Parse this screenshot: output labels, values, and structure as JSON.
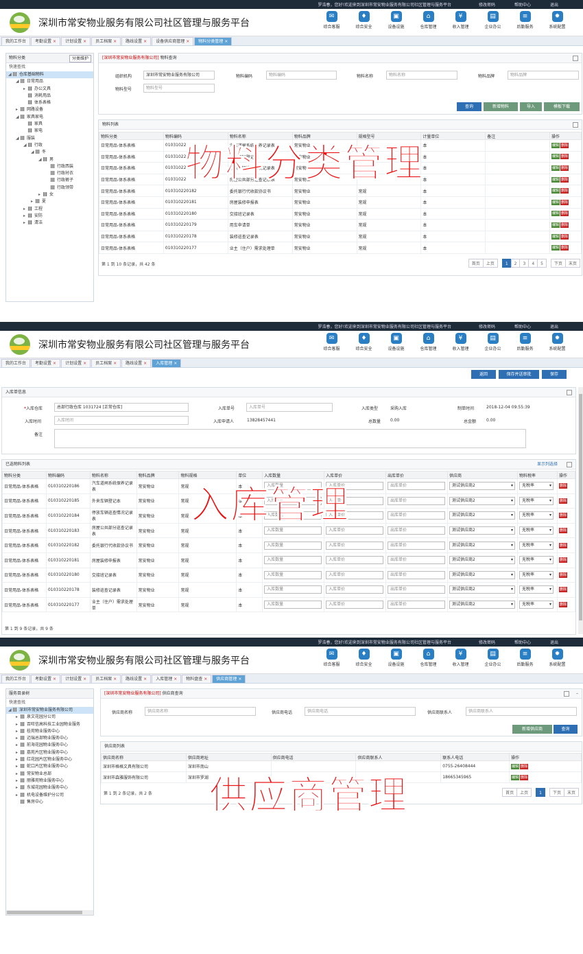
{
  "common": {
    "user": "罗浩春，您好!欢迎来到深圳市常安物业服务有限公司社区管理与服务平台",
    "links": [
      "修改密码",
      "帮助中心",
      "退出"
    ],
    "title": "深圳市常安物业服务有限公司社区管理与服务平台",
    "nav": [
      {
        "label": "综合客服",
        "icon": "✉"
      },
      {
        "label": "综合安全",
        "icon": "♦"
      },
      {
        "label": "设备设施",
        "icon": "▣"
      },
      {
        "label": "仓库管理",
        "icon": "⌂"
      },
      {
        "label": "收入管理",
        "icon": "¥"
      },
      {
        "label": "企业办公",
        "icon": "▤"
      },
      {
        "label": "后勤服务",
        "icon": "≡"
      },
      {
        "label": "系统配置",
        "icon": "✹"
      }
    ]
  },
  "s1": {
    "tabs": [
      "我的工作台",
      "考勤设置",
      "计划设置",
      "员工档案",
      "路线设置",
      "设备供应商管理",
      "物料分类管理"
    ],
    "side_title": "物料分类",
    "side_btn": "分类维护",
    "quick": "快速查找",
    "tree": [
      {
        "t": "仓库基础物料",
        "l": 0,
        "sel": true,
        "ar": "◢"
      },
      {
        "t": "日常用品",
        "l": 1,
        "ar": "◢"
      },
      {
        "t": "办公文具",
        "l": 2,
        "ar": "▸"
      },
      {
        "t": "消耗用品",
        "l": 2,
        "ar": ""
      },
      {
        "t": "体系表格",
        "l": 2,
        "ar": ""
      },
      {
        "t": "网路设备",
        "l": 1,
        "ar": "▸"
      },
      {
        "t": "家具家电",
        "l": 1,
        "ar": "◢"
      },
      {
        "t": "家具",
        "l": 2,
        "ar": ""
      },
      {
        "t": "家电",
        "l": 2,
        "ar": ""
      },
      {
        "t": "服装",
        "l": 1,
        "ar": "◢"
      },
      {
        "t": "行政",
        "l": 2,
        "ar": "◢"
      },
      {
        "t": "冬",
        "l": 3,
        "ar": "◢"
      },
      {
        "t": "男",
        "l": 4,
        "ar": "◢"
      },
      {
        "t": "行政西装",
        "l": 5,
        "ar": ""
      },
      {
        "t": "行政衬衣",
        "l": 5,
        "ar": ""
      },
      {
        "t": "行政裤子",
        "l": 5,
        "ar": ""
      },
      {
        "t": "行政领带",
        "l": 5,
        "ar": ""
      },
      {
        "t": "女",
        "l": 4,
        "ar": "▸"
      },
      {
        "t": "夏",
        "l": 3,
        "ar": "▸"
      },
      {
        "t": "工程",
        "l": 2,
        "ar": "▸"
      },
      {
        "t": "安防",
        "l": 2,
        "ar": "▸"
      },
      {
        "t": "清洁",
        "l": 2,
        "ar": "▸"
      }
    ],
    "query_org": "[深圳市常安物业服务有限公司]",
    "query_title": "物料查询",
    "labels": {
      "org": "组织机构",
      "code": "物料编码",
      "name": "物料名称",
      "brand": "物料品牌",
      "model": "物料型号"
    },
    "values": {
      "org": "深圳市常安物业服务有限公司"
    },
    "ph": {
      "code": "物料编码",
      "name": "物料名称",
      "brand": "物料品牌",
      "model": "物料型号"
    },
    "buttons": [
      "查询",
      "新增物料",
      "导入",
      "模板下载"
    ],
    "list_title": "物料列表",
    "cols": [
      "物料分类",
      "物料编码",
      "物料名称",
      "物料品牌",
      "规格型号",
      "计量单位",
      "备注",
      "操作"
    ],
    "rows": [
      [
        "日常用品-体系表格",
        "01031022",
        "汽车道闸系统保养记录表",
        "常安物业",
        "",
        "本",
        ""
      ],
      [
        "日常用品-体系表格",
        "01031022",
        "外来车辆登记本",
        "常安物业",
        "",
        "本",
        ""
      ],
      [
        "日常用品-体系表格",
        "01031022",
        "停放车辆巡查情况记录表",
        "常安物业",
        "",
        "本",
        ""
      ],
      [
        "日常用品-体系表格",
        "01031022",
        "房屋公共部分巡查记录表",
        "常安物业",
        "",
        "本",
        ""
      ],
      [
        "日常用品-体系表格",
        "010310220182",
        "委托银行代收款协议书",
        "常安物业",
        "常规",
        "本",
        ""
      ],
      [
        "日常用品-体系表格",
        "010310220181",
        "房屋装修申报表",
        "常安物业",
        "常规",
        "本",
        ""
      ],
      [
        "日常用品-体系表格",
        "010310220180",
        "交接班记录表",
        "常安物业",
        "常规",
        "本",
        ""
      ],
      [
        "日常用品-体系表格",
        "010310220179",
        "用车申请单",
        "常安物业",
        "常规",
        "本",
        ""
      ],
      [
        "日常用品-体系表格",
        "010310220178",
        "装修巡查记录表",
        "常安物业",
        "常规",
        "本",
        ""
      ],
      [
        "日常用品-体系表格",
        "010310220177",
        "业主（住户）需求处理单",
        "常安物业",
        "常规",
        "本",
        ""
      ]
    ],
    "ops": [
      "编辑",
      "删除"
    ],
    "summary": "第 1 到 10 条记录，共 42 条",
    "pager": [
      "首页",
      "上页",
      "1",
      "2",
      "3",
      "4",
      "5",
      "下页",
      "末页"
    ],
    "overlay": "物料分类管理"
  },
  "s2": {
    "tabs": [
      "我的工作台",
      "考勤设置",
      "计划设置",
      "员工档案",
      "路线设置",
      "入库管理"
    ],
    "top_btns": [
      "返回",
      "保存并送审批",
      "保存"
    ],
    "info_title": "入库单信息",
    "labels": {
      "wh": "入库仓库",
      "time": "入库时间",
      "no": "入库单号",
      "applicant": "入库申请人",
      "type": "入库类型",
      "maker_time": "制单时间",
      "qty": "总数量",
      "amount": "总金额",
      "remark": "备注"
    },
    "values": {
      "wh": "总部行政仓库 1031724 [正常仓库]",
      "applicant": "13828457441",
      "type": "采购入库",
      "maker_time": "2018-12-04 09:55:39",
      "qty": "0.00",
      "amount": "0.00"
    },
    "ph": {
      "time": "入库时间",
      "no": "入库单号"
    },
    "list_title": "已选物料列表",
    "list_link": "显示列选择",
    "cols": [
      "物料分类",
      "物料编码",
      "物料名称",
      "物料品牌",
      "物料规格",
      "单位",
      "入库数量",
      "入库单价",
      "出库单价",
      "供应商",
      "物料税率",
      "操作"
    ],
    "rows": [
      [
        "日常用品-体系表格",
        "010310220186",
        "汽车道闸系统保养记录表",
        "常安物业",
        "常规",
        "本"
      ],
      [
        "日常用品-体系表格",
        "010310220185",
        "外来车辆登记本",
        "常安物业",
        "常规",
        "本"
      ],
      [
        "日常用品-体系表格",
        "010310220184",
        "停放车辆巡查情况记录表",
        "常安物业",
        "常规",
        "本"
      ],
      [
        "日常用品-体系表格",
        "010310220183",
        "房屋公共部分巡查记录表",
        "常安物业",
        "常规",
        "本"
      ],
      [
        "日常用品-体系表格",
        "010310220182",
        "委托银行代收款协议书",
        "常安物业",
        "常规",
        "本"
      ],
      [
        "日常用品-体系表格",
        "010310220181",
        "房屋装修申报表",
        "常安物业",
        "常规",
        "本"
      ],
      [
        "日常用品-体系表格",
        "010310220180",
        "交接班记录表",
        "常安物业",
        "常规",
        "本"
      ],
      [
        "日常用品-体系表格",
        "010310220178",
        "装修巡查记录表",
        "常安物业",
        "常规",
        "本"
      ],
      [
        "日常用品-体系表格",
        "010310220177",
        "业主（住户）需求处理单",
        "常安物业",
        "常规",
        "本"
      ]
    ],
    "cell_ph": {
      "qty": "入库数量",
      "price": "入库单价",
      "out": "出库单价"
    },
    "supplier": "测试供应商2",
    "tax": "无税率",
    "op": "删除",
    "summary": "第 1 到 9 条记录，共 9 条",
    "overlay": "入库管理"
  },
  "s3": {
    "tabs": [
      "我的工作台",
      "考勤设置",
      "计划设置",
      "员工档案",
      "路线设置",
      "入库管理",
      "物料盘查",
      "供应商管理"
    ],
    "side_title": "服务目录树",
    "quick": "快速查找",
    "tree": [
      {
        "t": "深圳市常安物业服务有限公司",
        "l": 0,
        "sel": true,
        "ar": "◢"
      },
      {
        "t": "泉文花园分公司",
        "l": 1,
        "ar": "▸"
      },
      {
        "t": "百旺信高科技工业园物业服务",
        "l": 1,
        "ar": "▸"
      },
      {
        "t": "桂苑物业服务中心",
        "l": 1,
        "ar": "▸"
      },
      {
        "t": "迈瑞总部物业服务中心",
        "l": 1,
        "ar": "▸"
      },
      {
        "t": "前海花园物业服务中心",
        "l": 1,
        "ar": "▸"
      },
      {
        "t": "荔苑片区物业服务中心",
        "l": 1,
        "ar": "▸"
      },
      {
        "t": "红花园片区物业服务中心",
        "l": 1,
        "ar": "▸"
      },
      {
        "t": "蛇口片区物业服务中心",
        "l": 1,
        "ar": "▸"
      },
      {
        "t": "常安物业总部",
        "l": 1,
        "ar": "▸"
      },
      {
        "t": "丽雅苑物业服务中心",
        "l": 1,
        "ar": "▸"
      },
      {
        "t": "东城花园物业服务中心",
        "l": 1,
        "ar": "▸"
      },
      {
        "t": "机电设备维护分公司",
        "l": 1,
        "ar": "▸"
      },
      {
        "t": "售房中心",
        "l": 1,
        "ar": ""
      }
    ],
    "query_org": "[深圳市常安物业服务有限公司]",
    "query_title": "供应商查询",
    "labels": {
      "name": "供应商名称",
      "phone": "供应商电话",
      "contact": "供应商联系人"
    },
    "ph": {
      "name": "供应商名称",
      "phone": "供应商电话",
      "contact": "供应商联系人"
    },
    "buttons": [
      "新增供应商",
      "查询"
    ],
    "list_title": "供应商列表",
    "cols": [
      "供应商名称",
      "供应商地址",
      "供应商电话",
      "供应商联系人",
      "联系人电话",
      "操作"
    ],
    "rows": [
      [
        "深圳市格格文具有限公司",
        "深圳市南山",
        "",
        "",
        "0755-26408444"
      ],
      [
        "深圳市森雅服饰有限公司",
        "深圳市罗湖",
        "",
        "",
        "18665345965"
      ]
    ],
    "ops": [
      "编辑",
      "删除"
    ],
    "summary": "第 1 到 2 条记录，共 2 条",
    "pager": [
      "首页",
      "上页",
      "1",
      "下页",
      "末页"
    ],
    "overlay": "供应商管理"
  }
}
